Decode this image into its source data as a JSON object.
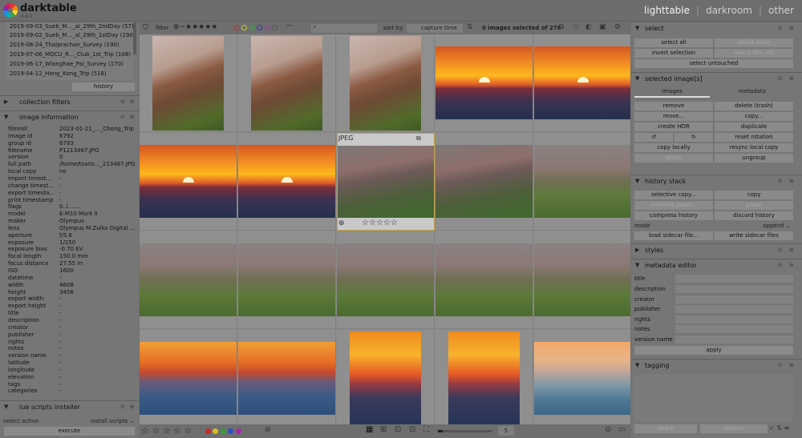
{
  "app": {
    "name": "darktable",
    "version": "4.4.2"
  },
  "views": {
    "lighttable": "lighttable",
    "darkroom": "darkroom",
    "other": "other",
    "sep": "|"
  },
  "left": {
    "collections": [
      "2019-09-03_Sueb_M..._al_29th_2ndDay (57)",
      "2019-09-02_Sueb_M..._al_29th_1stDay (190)",
      "2019-08-24_Thaiprachan_Survey (190)",
      "2019-07-06_MDCU_R..._Club_1st_Trip (108)",
      "2019-06-17_Wlanghae_Pai_Survey (170)",
      "2019-04-12_Hong_Kong_Trip (518)"
    ],
    "history_button": "history",
    "collection_filters": "collection filters",
    "image_information": "image information",
    "info": [
      {
        "k": "filmroll",
        "v": "2023-01-21_..._Chong_Trip"
      },
      {
        "k": "image id",
        "v": "6792"
      },
      {
        "k": "group id",
        "v": "6793"
      },
      {
        "k": "filename",
        "v": "P1213467.JPG"
      },
      {
        "k": "version",
        "v": "0"
      },
      {
        "k": "full path",
        "v": "/home/tsaris..._213467.JPG"
      },
      {
        "k": "local copy",
        "v": "no"
      },
      {
        "k": "import timest...",
        "v": "-"
      },
      {
        "k": "change timest...",
        "v": "-"
      },
      {
        "k": "export timesta...",
        "v": "-"
      },
      {
        "k": "print timestamp",
        "v": "-"
      },
      {
        "k": "flags",
        "v": "0..l......."
      },
      {
        "k": "model",
        "v": "E-M10 Mark II"
      },
      {
        "k": "maker",
        "v": "Olympus"
      },
      {
        "k": "lens",
        "v": "Olympus M.Zuiko Digital ..."
      },
      {
        "k": "aperture",
        "v": "f/5.6"
      },
      {
        "k": "exposure",
        "v": "1/250"
      },
      {
        "k": "exposure bias",
        "v": "-0.70 EV"
      },
      {
        "k": "focal length",
        "v": "150.0 mm"
      },
      {
        "k": "focus distance",
        "v": "27.55 m"
      },
      {
        "k": "ISO",
        "v": "1600"
      },
      {
        "k": "datetime",
        "v": "-"
      },
      {
        "k": "width",
        "v": "4608"
      },
      {
        "k": "height",
        "v": "3456"
      },
      {
        "k": "export width",
        "v": "-"
      },
      {
        "k": "export height",
        "v": "-"
      },
      {
        "k": "title",
        "v": "-"
      },
      {
        "k": "description",
        "v": "-"
      },
      {
        "k": "creator",
        "v": "-"
      },
      {
        "k": "publisher",
        "v": "-"
      },
      {
        "k": "rights",
        "v": "-"
      },
      {
        "k": "notes",
        "v": "-"
      },
      {
        "k": "version name",
        "v": "-"
      },
      {
        "k": "latitude",
        "v": "-"
      },
      {
        "k": "longitude",
        "v": "-"
      },
      {
        "k": "elevation",
        "v": "-"
      },
      {
        "k": "tags",
        "v": "-"
      },
      {
        "k": "categories",
        "v": "-"
      }
    ],
    "lua_scripts_installer": "lua scripts installer",
    "select_action": "select action",
    "install_scripts": "install scripts",
    "execute": "execute"
  },
  "topbar": {
    "filter": "filter",
    "sort_by": "sort by",
    "sort_value": "capture time",
    "selection_count": "0 images selected of 276"
  },
  "grid": {
    "hover_label": "JPEG",
    "columns_value": "5"
  },
  "right": {
    "select": {
      "title": "select",
      "select_all": "select all",
      "select_none": "select none",
      "invert_selection": "invert selection",
      "select_film_roll": "select film roll",
      "select_untouched": "select untouched"
    },
    "selected_images": {
      "title": "selected image[s]",
      "tab_images": "images",
      "tab_metadata": "metadata",
      "remove": "remove",
      "delete": "delete (trash)",
      "move": "move...",
      "copy": "copy...",
      "create_hdr": "create HDR",
      "duplicate": "duplicate",
      "reset_rotation": "reset rotation",
      "copy_locally": "copy locally",
      "resync_local_copy": "resync local copy",
      "group": "group",
      "ungroup": "ungroup"
    },
    "history_stack": {
      "title": "history stack",
      "selective_copy": "selective copy...",
      "copy": "copy",
      "selective_paste": "selective paste...",
      "paste": "paste",
      "compress_history": "compress history",
      "discard_history": "discard history",
      "mode_label": "mode",
      "mode_value": "append",
      "load_sidecar": "load sidecar file...",
      "write_sidecar": "write sidecar files"
    },
    "styles": "styles",
    "metadata_editor": {
      "title": "metadata editor",
      "fields": [
        "title",
        "description",
        "creator",
        "publisher",
        "rights",
        "notes",
        "version name"
      ],
      "apply": "apply"
    },
    "tagging": {
      "title": "tagging",
      "attach": "attach",
      "detach": "detach"
    }
  },
  "colors": {
    "accent_selected": "#c8a23a",
    "panel": "#767676",
    "grid_bg": "#8b8b8b"
  }
}
